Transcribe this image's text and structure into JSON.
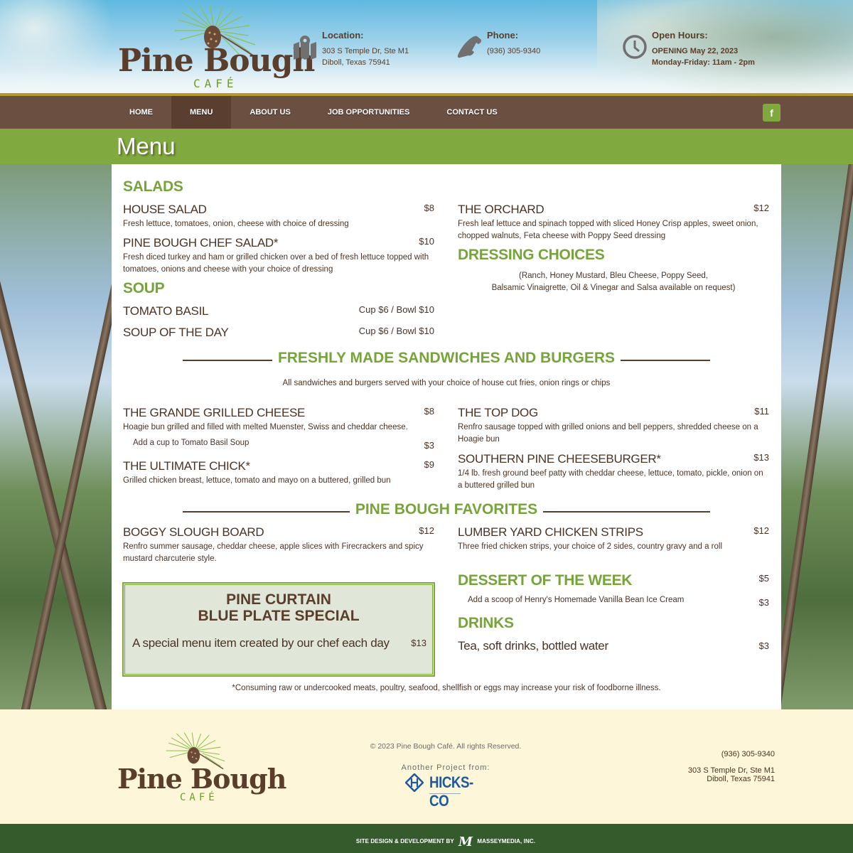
{
  "header": {
    "logo": {
      "brand": "Pine Bough",
      "sub": "CAFÉ"
    },
    "location": {
      "icon": "map-pin-icon",
      "label": "Location:",
      "line1": "303 S Temple Dr, Ste M1",
      "line2": "Diboll, Texas 75941"
    },
    "phone": {
      "icon": "phone-icon",
      "label": "Phone:",
      "line1": "(936) 305-9340"
    },
    "hours": {
      "icon": "clock-icon",
      "label": "Open Hours:",
      "line1": "OPENING May 22, 2023",
      "line2": "Monday-Friday: 11am - 2pm"
    }
  },
  "nav": {
    "items": [
      {
        "label": "HOME",
        "active": false
      },
      {
        "label": "MENU",
        "active": true
      },
      {
        "label": "ABOUT US",
        "active": false
      },
      {
        "label": "JOB OPPORTUNITIES",
        "active": false
      },
      {
        "label": "CONTACT US",
        "active": false
      }
    ],
    "facebook": {
      "icon": "facebook-icon",
      "glyph": "f"
    }
  },
  "page_title": "Menu",
  "colors": {
    "brown": "#6b4f41",
    "green": "#80a93f",
    "heading_green": "#77a43a",
    "footer_bg": "#fdf6d9",
    "bottom_bar": "#355a2b"
  },
  "menu": {
    "salads": {
      "heading": "SALADS",
      "items": [
        {
          "name": "HOUSE SALAD",
          "price": "$8",
          "desc": "Fresh lettuce, tomatoes, onion, cheese with choice of dressing"
        },
        {
          "name": "PINE BOUGH CHEF SALAD*",
          "price": "$10",
          "desc": "Fresh diced turkey and ham or grilled chicken over a bed of fresh lettuce topped with tomatoes, onions and cheese with your choice of dressing"
        },
        {
          "name": "THE ORCHARD",
          "price": "$12",
          "desc": "Fresh leaf lettuce and spinach topped with sliced Honey Crisp apples, sweet onion, chopped walnuts, Feta cheese with Poppy Seed dressing"
        }
      ]
    },
    "dressing": {
      "heading": "DRESSING CHOICES",
      "line1": "(Ranch, Honey Mustard, Bleu Cheese, Poppy Seed,",
      "line2": "Balsamic Vinaigrette, Oil & Vinegar and Salsa available on request)"
    },
    "soup": {
      "heading": "SOUP",
      "items": [
        {
          "name": "TOMATO BASIL",
          "price": "Cup $6 / Bowl $10"
        },
        {
          "name": "SOUP OF THE DAY",
          "price": "Cup $6 / Bowl $10"
        }
      ]
    },
    "sandwiches": {
      "heading": "FRESHLY MADE SANDWICHES AND BURGERS",
      "note": "All sandwiches and burgers served with your choice of house cut fries, onion rings or chips",
      "items": [
        {
          "name": "THE GRANDE GRILLED CHEESE",
          "price": "$8",
          "desc": "Hoagie bun grilled and filled with melted Muenster, Swiss and cheddar cheese."
        },
        {
          "name": "THE ULTIMATE CHICK*",
          "price": "$9",
          "desc": "Grilled chicken breast, lettuce, tomato and mayo on a buttered, grilled bun"
        },
        {
          "name": "THE TOP DOG",
          "price": "$11",
          "desc": "Renfro sausage topped with grilled onions and bell peppers, shredded cheese on a Hoagie bun"
        },
        {
          "name": "SOUTHERN PINE CHEESEBURGER*",
          "price": "$13",
          "desc": "1/4 lb. fresh ground beef patty with cheddar cheese, lettuce, tomato, pickle, onion on a buttered grilled bun"
        }
      ],
      "addon": {
        "text": "Add a cup to Tomato Basil Soup",
        "price": "$3"
      }
    },
    "favorites": {
      "heading": "PINE BOUGH FAVORITES",
      "items": [
        {
          "name": "BOGGY SLOUGH BOARD",
          "price": "$12",
          "desc": "Renfro summer sausage, cheddar cheese, apple slices with Firecrackers and spicy mustard charcuterie style."
        },
        {
          "name": "LUMBER YARD CHICKEN STRIPS",
          "price": "$12",
          "desc": "Three fried chicken strips, your choice of 2 sides, country gravy and a roll"
        }
      ]
    },
    "special": {
      "title1": "PINE CURTAIN",
      "title2": "BLUE PLATE SPECIAL",
      "desc": "A special menu item created by our chef each day",
      "price": "$13"
    },
    "dessert": {
      "heading": "DESSERT OF THE WEEK",
      "price": "$5",
      "addon": {
        "text": "Add a scoop of Henry's Homemade Vanilla Bean Ice Cream",
        "price": "$3"
      }
    },
    "drinks": {
      "heading": "DRINKS",
      "item": {
        "name": "Tea, soft drinks, bottled water",
        "price": "$3"
      }
    },
    "disclaimer": "*Consuming raw or undercooked meats, poultry, seafood, shellfish or eggs may increase your risk of foodborne illness."
  },
  "footer": {
    "copyright": "© 2023 Pine Bough Café. All rights Reserved.",
    "another_project": "Another Project from:",
    "partner": "HICKS-CO",
    "phone": "(936) 305-9340",
    "address1": "303 S Temple Dr, Ste M1",
    "address2": "Diboll, Texas 75941",
    "credit_prefix": "SITE DESIGN & DEVELOPMENT BY",
    "credit_mark": "M",
    "credit_company": "MASSEYMEDIA, INC."
  }
}
